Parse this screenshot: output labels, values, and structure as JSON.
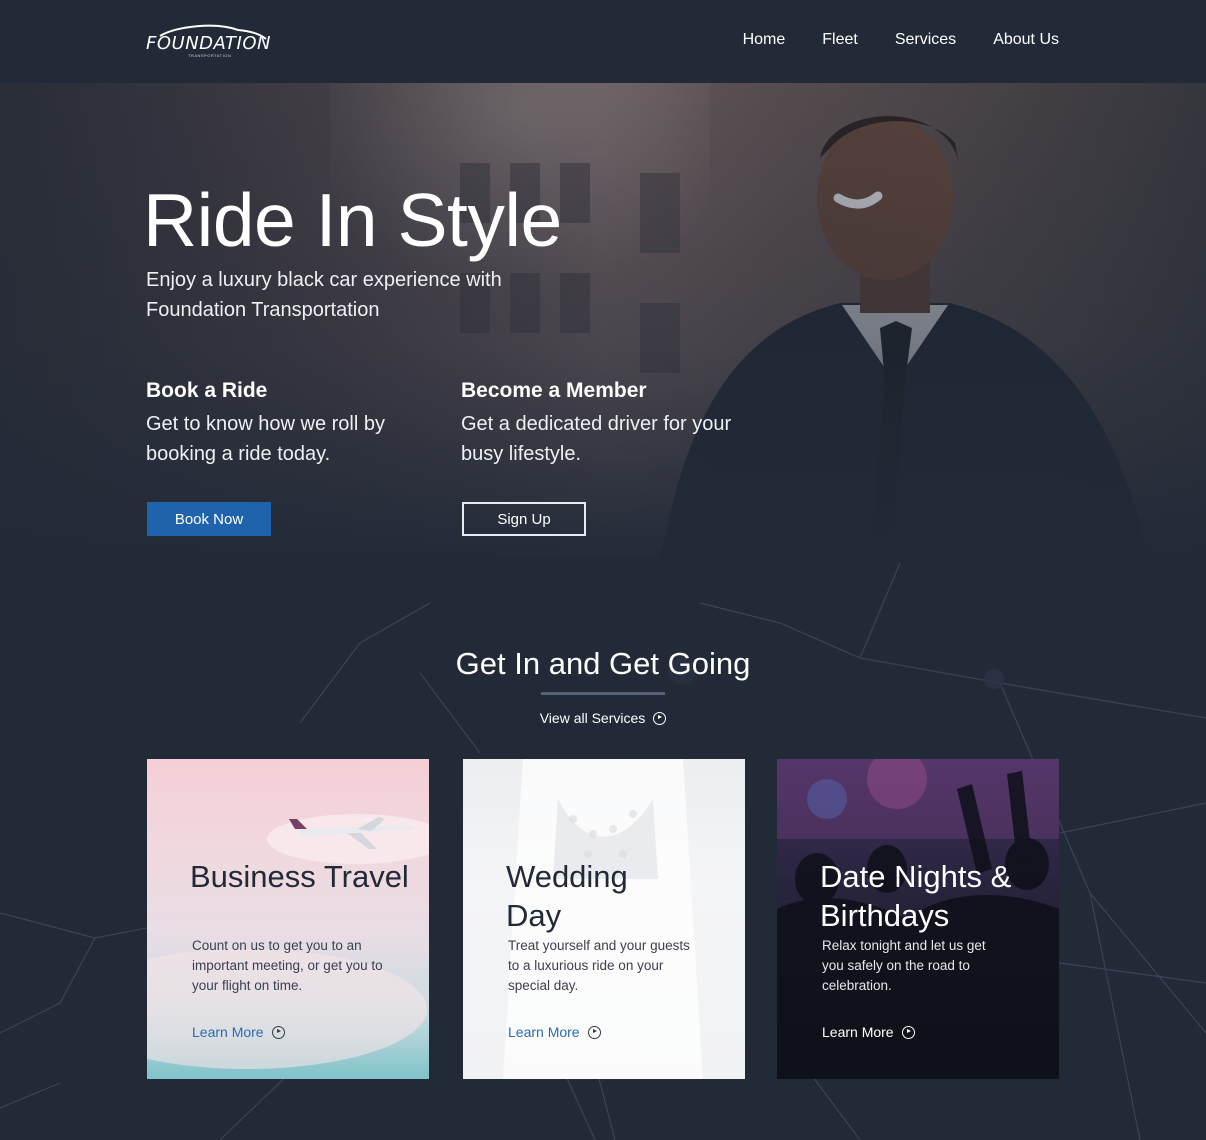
{
  "header": {
    "logo_text": "FOUNDATION",
    "logo_subtext": "TRANSPORTATION",
    "nav": [
      {
        "label": "Home"
      },
      {
        "label": "Fleet"
      },
      {
        "label": "Services"
      },
      {
        "label": "About Us"
      }
    ]
  },
  "hero": {
    "title": "Ride In Style",
    "subtitle": "Enjoy a luxury black car experience with Foundation Transportation",
    "book": {
      "heading": "Book a Ride",
      "text": "Get to know how we roll by booking a ride today.",
      "button": "Book Now"
    },
    "member": {
      "heading": "Become a Member",
      "text": "Get a dedicated driver for your busy lifestyle.",
      "button": "Sign Up"
    }
  },
  "services": {
    "title": "Get In and Get Going",
    "view_all": "View all Services",
    "cards": [
      {
        "title": "Business Travel",
        "text": "Count on us to get you to an important meeting, or get you to your flight on time.",
        "link": "Learn More"
      },
      {
        "title": "Wedding Day",
        "text": "Treat yourself and your guests to a luxurious ride on your special day.",
        "link": "Learn More"
      },
      {
        "title": "Date Nights & Birthdays",
        "text": "Relax tonight and let us get you safely on the road to celebration.",
        "link": "Learn More"
      }
    ]
  },
  "colors": {
    "background": "#222a38",
    "primary_button": "#1f63ac",
    "link": "#2a6bb3"
  }
}
